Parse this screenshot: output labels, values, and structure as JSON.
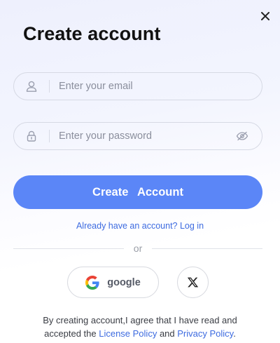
{
  "dialog": {
    "title": "Create account",
    "close_icon": "close-icon"
  },
  "email_field": {
    "placeholder": "Enter your email",
    "value": "",
    "icon": "user-icon"
  },
  "password_field": {
    "placeholder": "Enter your password",
    "value": "",
    "icon": "lock-icon",
    "toggle_icon": "eye-off-icon"
  },
  "primary_button": {
    "label": "Create  Account",
    "color": "#5b86f7"
  },
  "login_link": {
    "text": "Already have an account? Log in"
  },
  "divider": {
    "text": "or"
  },
  "social": {
    "google_label": "google",
    "google_icon": "google-icon",
    "x_icon": "x-logo-icon"
  },
  "terms": {
    "line1": "By creating account,I agree that I have read and",
    "prefix": "accepted the ",
    "license_link": "License Policy",
    "middle": " and ",
    "privacy_link": "Privacy Policy",
    "suffix": "."
  },
  "colors": {
    "accent": "#5b86f7",
    "link": "#3d6be0"
  }
}
